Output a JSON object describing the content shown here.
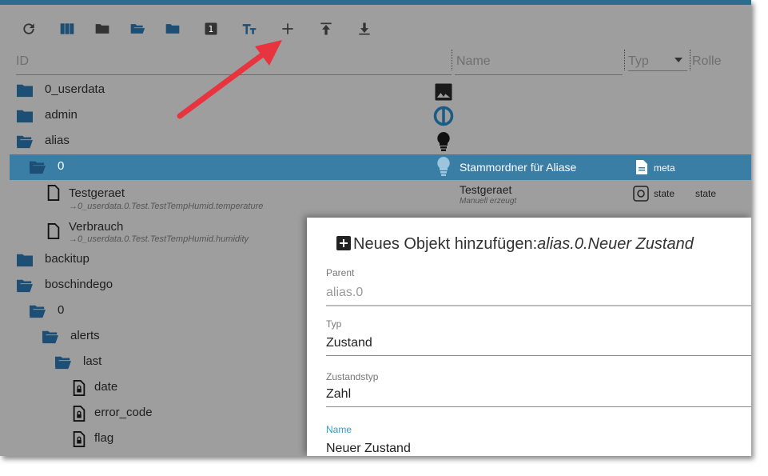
{
  "toolbar": {
    "buttons": [
      {
        "name": "refresh-icon"
      },
      {
        "name": "columns-icon"
      },
      {
        "name": "folder-closed-icon"
      },
      {
        "name": "folder-open-icon"
      },
      {
        "name": "folder-icon"
      },
      {
        "name": "counter-badge-icon",
        "label": "1"
      },
      {
        "name": "text-size-icon"
      },
      {
        "name": "add-icon"
      },
      {
        "name": "upload-icon"
      },
      {
        "name": "download-icon"
      }
    ]
  },
  "columns": {
    "id": "ID",
    "name": "Name",
    "type": "Typ",
    "role": "Rolle"
  },
  "tree": {
    "r0": {
      "label": "0_userdata"
    },
    "r1": {
      "label": "admin"
    },
    "r2": {
      "label": "alias"
    },
    "r3": {
      "label": "0",
      "name": "Stammordner für Aliase",
      "type": "meta"
    },
    "r4": {
      "label": "Testgeraet",
      "sub": "→0_userdata.0.Test.TestTempHumid.temperature",
      "name": "Testgeraet",
      "name_sub": "Manuell erzeugt",
      "type": "state",
      "role": "state"
    },
    "r5": {
      "label": "Verbrauch",
      "sub": "→0_userdata.0.Test.TestTempHumid.humidity"
    },
    "r6": {
      "label": "backitup"
    },
    "r7": {
      "label": "boschindego"
    },
    "r8": {
      "label": "0"
    },
    "r9": {
      "label": "alerts"
    },
    "r10": {
      "label": "last"
    },
    "r11": {
      "label": "date"
    },
    "r12": {
      "label": "error_code"
    },
    "r13": {
      "label": "flag"
    }
  },
  "dialog": {
    "title_prefix": "Neues Objekt hinzufügen:",
    "title_path": "alias.0.Neuer Zustand",
    "parent_label": "Parent",
    "parent_value": "alias.0",
    "type_label": "Typ",
    "type_value": "Zustand",
    "statetype_label": "Zustandstyp",
    "statetype_value": "Zahl",
    "name_label": "Name",
    "name_value": "Neuer Zustand"
  },
  "colors": {
    "accent": "#3a7ea6",
    "folder": "#1d4f74",
    "name_label": "#2a9fd6"
  }
}
